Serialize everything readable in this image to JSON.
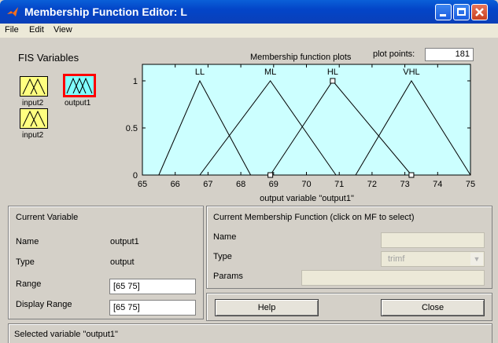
{
  "window": {
    "title": "Membership Function Editor: L"
  },
  "menu": [
    "File",
    "Edit",
    "View"
  ],
  "fis_variables": {
    "label": "FIS Variables",
    "variables": [
      {
        "name": "input2",
        "selected": false
      },
      {
        "name": "output1",
        "selected": true
      },
      {
        "name": "input2",
        "selected": false
      }
    ]
  },
  "plot": {
    "caption": "Membership function plots",
    "plot_points_label": "plot points:",
    "plot_points_value": "181"
  },
  "chart_data": {
    "type": "line",
    "xlabel": "output variable \"output1\"",
    "xlim": [
      65,
      75
    ],
    "ylim": [
      0,
      1
    ],
    "x_ticks": [
      "65",
      "66",
      "67",
      "68",
      "69",
      "70",
      "71",
      "72",
      "73",
      "74",
      "75"
    ],
    "y_ticks": [
      "0",
      "0.5",
      "1"
    ],
    "series": [
      {
        "name": "LL",
        "params": [
          65.5,
          66.75,
          68.3
        ]
      },
      {
        "name": "ML",
        "params": [
          66.75,
          68.9,
          70.9
        ]
      },
      {
        "name": "HL",
        "params": [
          68.9,
          70.8,
          73.2
        ]
      },
      {
        "name": "VHL",
        "params": [
          71.5,
          73.2,
          75
        ]
      }
    ],
    "selected_series": "HL",
    "colors": {
      "background": "#ccffff",
      "line": "#000000",
      "selected_line": "#ff0000"
    }
  },
  "current_variable": {
    "title": "Current Variable",
    "name_label": "Name",
    "name_value": "output1",
    "type_label": "Type",
    "type_value": "output",
    "range_label": "Range",
    "range_value": "[65 75]",
    "display_range_label": "Display Range",
    "display_range_value": "[65 75]"
  },
  "current_mf": {
    "title": "Current Membership Function (click on MF to select)",
    "name_label": "Name",
    "name_value": "",
    "type_label": "Type",
    "type_value": "trimf",
    "params_label": "Params",
    "params_value": ""
  },
  "buttons": {
    "help": "Help",
    "close": "Close"
  },
  "status": "Selected variable \"output1\""
}
